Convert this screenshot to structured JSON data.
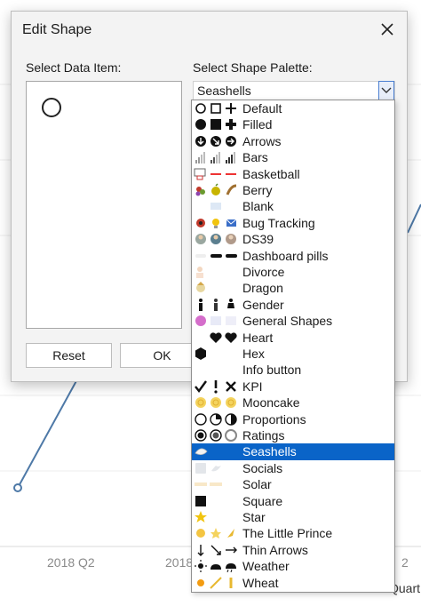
{
  "background": {
    "x_labels": [
      "2018 Q2",
      "2018",
      "2"
    ],
    "axis_title_fragment": "Quart"
  },
  "dialog": {
    "title": "Edit Shape",
    "close_icon": "close-icon",
    "select_data_item_label": "Select Data Item:",
    "select_palette_label": "Select Shape Palette:",
    "selected_palette": "Seashells",
    "reset_label": "Reset",
    "ok_label": "OK"
  },
  "palettes": [
    {
      "label": "Default",
      "icon": "default-shapes-icon"
    },
    {
      "label": "Filled",
      "icon": "filled-shapes-icon"
    },
    {
      "label": "Arrows",
      "icon": "arrows-icon"
    },
    {
      "label": "Bars",
      "icon": "bars-icon"
    },
    {
      "label": "Basketball",
      "icon": "basketball-icon"
    },
    {
      "label": "Berry",
      "icon": "berry-icon"
    },
    {
      "label": "Blank",
      "icon": "blank-icon"
    },
    {
      "label": "Bug Tracking",
      "icon": "bug-tracking-icon"
    },
    {
      "label": "DS39",
      "icon": "ds39-icon"
    },
    {
      "label": "Dashboard pills",
      "icon": "dashboard-pills-icon"
    },
    {
      "label": "Divorce",
      "icon": "divorce-icon"
    },
    {
      "label": "Dragon",
      "icon": "dragon-icon"
    },
    {
      "label": "Gender",
      "icon": "gender-icon"
    },
    {
      "label": "General Shapes",
      "icon": "general-shapes-icon"
    },
    {
      "label": "Heart",
      "icon": "heart-icon"
    },
    {
      "label": "Hex",
      "icon": "hex-icon"
    },
    {
      "label": "Info button",
      "icon": "info-button-icon"
    },
    {
      "label": "KPI",
      "icon": "kpi-icon"
    },
    {
      "label": "Mooncake",
      "icon": "mooncake-icon"
    },
    {
      "label": "Proportions",
      "icon": "proportions-icon"
    },
    {
      "label": "Ratings",
      "icon": "ratings-icon"
    },
    {
      "label": "Seashells",
      "icon": "seashells-icon",
      "selected": true
    },
    {
      "label": "Socials",
      "icon": "socials-icon"
    },
    {
      "label": "Solar",
      "icon": "solar-icon"
    },
    {
      "label": "Square",
      "icon": "square-icon"
    },
    {
      "label": "Star",
      "icon": "star-icon"
    },
    {
      "label": "The Little Prince",
      "icon": "little-prince-icon"
    },
    {
      "label": "Thin Arrows",
      "icon": "thin-arrows-icon"
    },
    {
      "label": "Weather",
      "icon": "weather-icon"
    },
    {
      "label": "Wheat",
      "icon": "wheat-icon"
    }
  ],
  "colors": {
    "selection": "#0a64c8",
    "line": "#4e79a7"
  }
}
